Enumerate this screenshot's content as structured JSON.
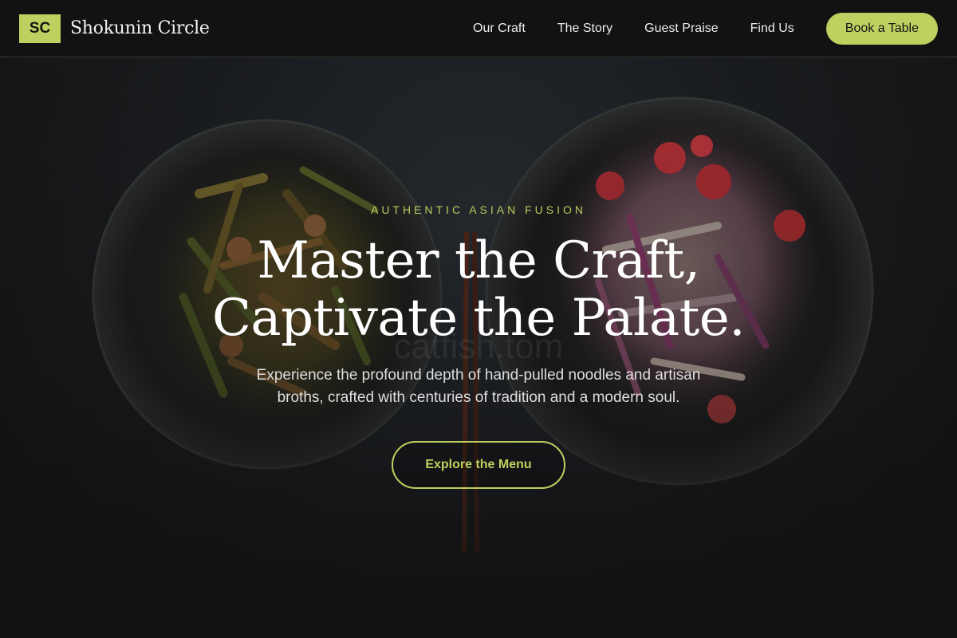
{
  "header": {
    "logo_mark": "SC",
    "brand_name": "Shokunin Circle",
    "nav": [
      {
        "label": "Our Craft"
      },
      {
        "label": "The Story"
      },
      {
        "label": "Guest Praise"
      },
      {
        "label": "Find Us"
      }
    ],
    "cta_label": "Book a Table"
  },
  "hero": {
    "watermark": "catfish.tom",
    "eyebrow": "AUTHENTIC ASIAN FUSION",
    "headline_line1": "Master the Craft,",
    "headline_line2": "Captivate the Palate.",
    "subtext_line1": "Experience the profound depth of hand-pulled noodles and artisan",
    "subtext_line2": "broths, crafted with centuries of tradition and a modern soul.",
    "button_label": "Explore the Menu"
  },
  "colors": {
    "accent": "#bcd15f",
    "header_bg": "#121212",
    "hero_bg": "#161616",
    "text": "#ffffff"
  }
}
